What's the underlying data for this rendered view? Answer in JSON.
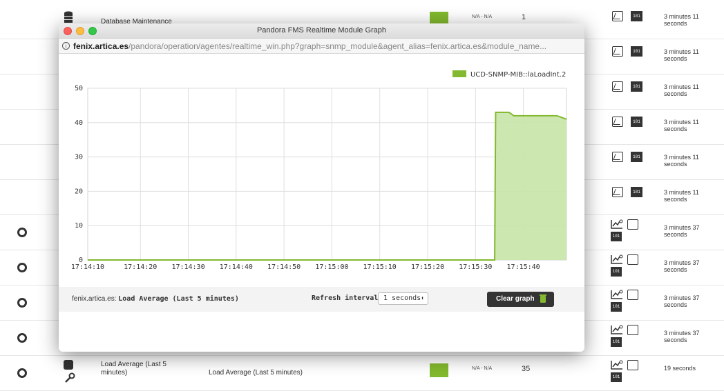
{
  "background_rows": [
    {
      "kind": "db",
      "name": "Database Maintenance",
      "interval": "N/A - N/A",
      "count": "1",
      "last": "3 minutes 11 seconds"
    },
    {
      "kind": "plain",
      "last": "3 minutes 11 seconds"
    },
    {
      "kind": "plain",
      "last": "3 minutes 11 seconds"
    },
    {
      "kind": "plain",
      "last": "3 minutes 11 seconds"
    },
    {
      "kind": "plain",
      "last": "3 minutes 11 seconds"
    },
    {
      "kind": "plain",
      "last": "3 minutes 11 seconds"
    },
    {
      "kind": "radio",
      "last": "3 minutes 37 seconds"
    },
    {
      "kind": "radio",
      "last": "3 minutes 37 seconds"
    },
    {
      "kind": "radio",
      "last": "3 minutes 37 seconds"
    },
    {
      "kind": "radio",
      "last": "3 minutes 37 seconds"
    },
    {
      "kind": "agent",
      "name": "Load Average (Last 5 minutes)",
      "description": "Load Average (Last 5 minutes)",
      "interval": "N/A - N/A",
      "count": "35",
      "last": "19 seconds"
    }
  ],
  "action_icon_label": "101",
  "popup": {
    "title": "Pandora FMS Realtime Module Graph",
    "url_host": "fenix.artica.es",
    "url_path": "/pandora/operation/agentes/realtime_win.php?graph=snmp_module&agent_alias=fenix.artica.es&module_name...",
    "agent_label": "fenix.artica.es:",
    "module_name": "Load Average (Last 5 minutes)",
    "refresh_label": "Refresh interval",
    "refresh_value": "1 seconds",
    "clear_button": "Clear graph"
  },
  "colors": {
    "accent": "#82b92e",
    "fill": "#c8e4a9",
    "dark": "#343434"
  },
  "chart_data": {
    "type": "area",
    "legend": [
      "UCD-SNMP-MIB::laLoadInt.2"
    ],
    "legend_position": "top-right",
    "x_tick_labels": [
      "17:14:10",
      "17:14:20",
      "17:14:30",
      "17:14:40",
      "17:14:50",
      "17:15:00",
      "17:15:10",
      "17:15:20",
      "17:15:30",
      "17:15:40"
    ],
    "x_range_seconds": [
      0,
      100
    ],
    "y_ticks": [
      0,
      10,
      20,
      30,
      40,
      50
    ],
    "ylim": [
      0,
      50
    ],
    "grid": true,
    "series": [
      {
        "name": "UCD-SNMP-MIB::laLoadInt.2",
        "points": [
          [
            0,
            0
          ],
          [
            85,
            0
          ],
          [
            85.2,
            43
          ],
          [
            88,
            43
          ],
          [
            89,
            42
          ],
          [
            98,
            42
          ],
          [
            100,
            41
          ]
        ]
      }
    ]
  }
}
